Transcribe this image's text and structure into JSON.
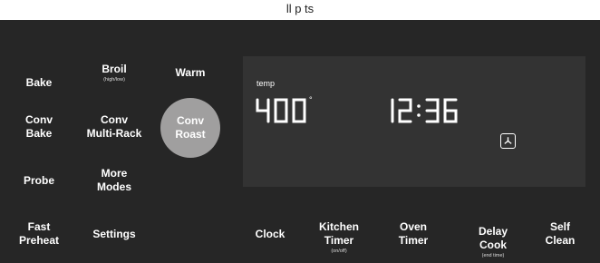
{
  "header": {
    "partial_text": "ll         p    ts"
  },
  "left_keys": {
    "bake": "Bake",
    "broil": "Broil",
    "broil_sub": "(high/low)",
    "warm": "Warm",
    "conv_bake": [
      "Conv",
      "Bake"
    ],
    "conv_multi_rack": [
      "Conv",
      "Multi-Rack"
    ],
    "conv_roast": [
      "Conv",
      "Roast"
    ],
    "probe": "Probe",
    "more_modes": [
      "More",
      "Modes"
    ],
    "fast_preheat": [
      "Fast",
      "Preheat"
    ],
    "settings": "Settings"
  },
  "display": {
    "temp_label": "temp",
    "temperature": "400",
    "degree_symbol": "°",
    "time": "12:36",
    "fan_icon": "convection-fan-icon"
  },
  "bottom_keys": {
    "clock": "Clock",
    "kitchen_timer": [
      "Kitchen",
      "Timer"
    ],
    "kitchen_timer_sub": "(on/off)",
    "oven_timer": [
      "Oven",
      "Timer"
    ],
    "delay_cook": [
      "Delay",
      "Cook"
    ],
    "delay_cook_sub": "(end time)",
    "self_clean": [
      "Self",
      "Clean"
    ]
  },
  "colors": {
    "background": "#262626",
    "panel": "#333333",
    "active_key": "#a09f9f",
    "text": "#ffffff"
  }
}
